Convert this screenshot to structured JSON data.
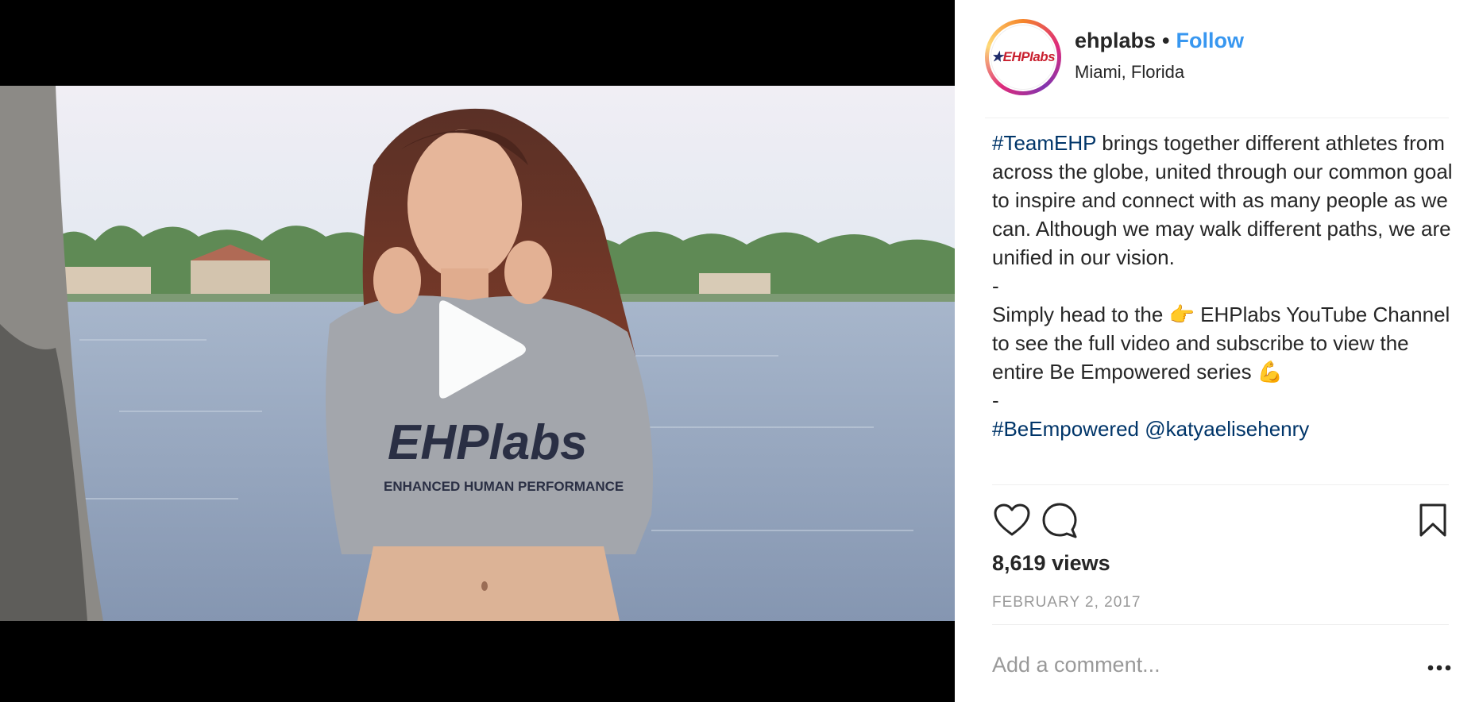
{
  "post": {
    "username": "ehplabs",
    "separator": "•",
    "follow_label": "Follow",
    "location": "Miami, Florida",
    "avatar_logo": "EHPlabs",
    "caption": {
      "hashtag_team": "#TeamEHP",
      "para1": " brings together different athletes from across the globe, united through our common goal to inspire and connect with as many people as we can. Although we may walk different paths, we are unified in our vision.",
      "dash1": "-",
      "para2_before": "Simply head to the ",
      "pointing_emoji": "👉",
      "para2_after": " EHPlabs YouTube Channel to see the full video and subscribe to view the entire Be Empowered series ",
      "muscle_emoji": "💪",
      "dash2": "-",
      "hashtag_be": "#BeEmpowered",
      "mention": "@katyaelisehenry"
    },
    "views": "8,619 views",
    "date": "FEBRUARY 2, 2017",
    "comment_placeholder": "Add a comment..."
  },
  "video": {
    "shirt_logo": "EHPlabs",
    "shirt_sub": "ENHANCED HUMAN PERFORMANCE"
  },
  "icons": {
    "play": "play-icon",
    "like": "heart-icon",
    "comment": "comment-icon",
    "save": "bookmark-icon",
    "more": "more-options-icon"
  },
  "colors": {
    "follow": "#3897f0",
    "hashtag": "#003569",
    "muted": "#999999",
    "text": "#262626"
  }
}
